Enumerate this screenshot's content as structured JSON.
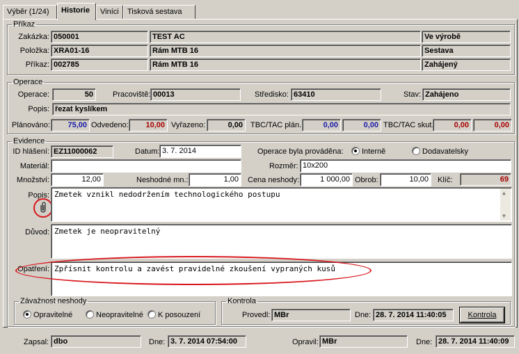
{
  "tabs": [
    "Výběr (1/24)",
    "Historie",
    "Viníci",
    "Tisková sestava"
  ],
  "prikaz": {
    "legend": "Příkaz",
    "zakazka": {
      "label": "Zakázka:",
      "code": "050001",
      "name": "TEST AC",
      "status": "Ve výrobě"
    },
    "polozka": {
      "label": "Položka:",
      "code": "XRA01-16",
      "name": "Rám MTB 16",
      "status": "Sestava"
    },
    "prikaz": {
      "label": "Příkaz:",
      "code": "002785",
      "name": "Rám MTB 16",
      "status": "Zahájený"
    }
  },
  "operace": {
    "legend": "Operace",
    "operace_label": "Operace:",
    "operace_value": "50",
    "pracoviste_label": "Pracoviště:",
    "pracoviste_value": "00013",
    "stredisko_label": "Středisko:",
    "stredisko_value": "63410",
    "stav_label": "Stav:",
    "stav_value": "Zahájeno",
    "popis_label": "Popis:",
    "popis_value": "řezat kyslíkem",
    "planovano_label": "Plánováno:",
    "planovano_value": "75,00",
    "odvedeno_label": "Odvedeno:",
    "odvedeno_value": "10,00",
    "vyrazeno_label": "Vyřazeno:",
    "vyrazeno_value": "0,00",
    "tbc_plan_label": "TBC/TAC plán.:",
    "tbc_plan_value1": "0,00",
    "tbc_plan_value2": "0,00",
    "tbc_skut_label": "TBC/TAC skut.:",
    "tbc_skut_value1": "0,00",
    "tbc_skut_value2": "0,00"
  },
  "evidence": {
    "legend": "Evidence",
    "id_label": "ID hlášení:",
    "id_value": "EZ11000062",
    "datum_label": "Datum:",
    "datum_value": "3. 7. 2014",
    "provadena_label": "Operace byla prováděna:",
    "interne_label": "Interně",
    "dodavatelsky_label": "Dodavatelsky",
    "material_label": "Materiál:",
    "material_value": "",
    "rozmer_label": "Rozměr:",
    "rozmer_value": "10x200",
    "mnozstvi_label": "Množství:",
    "mnozstvi_value": "12,00",
    "neshodne_label": "Neshodné mn.:",
    "neshodne_value": "1,00",
    "cena_label": "Cena neshody:",
    "cena_value": "1 000,00",
    "obrob_label": "Obrob:",
    "obrob_value": "10,00",
    "klic_label": "Klíč:",
    "klic_value": "69",
    "popis_label": "Popis:",
    "popis_text": "Zmetek vznikl nedodržením technologického postupu",
    "duvod_label": "Důvod:",
    "duvod_text": "Zmetek je neopravitelný",
    "opatreni_label": "Opatření:",
    "opatreni_text": "Zpřísnit kontrolu a zavést pravidelné zkoušení vypraných kusů"
  },
  "zavaznost": {
    "legend": "Závažnost neshody",
    "options": [
      "Opravitelné",
      "Neopravitelné",
      "K posouzení"
    ]
  },
  "kontrola": {
    "legend": "Kontrola",
    "provedl_label": "Provedl:",
    "provedl_value": "MBr",
    "dne_label": "Dne:",
    "dne_value": "28. 7. 2014 11:40:05",
    "button_label": "Kontrola"
  },
  "footer": {
    "zapsal_label": "Zapsal:",
    "zapsal_value": "dbo",
    "dne1_label": "Dne:",
    "dne1_value": "3. 7. 2014 07:54:00",
    "opravil_label": "Opravil:",
    "opravil_value": "MBr",
    "dne2_label": "Dne:",
    "dne2_value": "28. 7. 2014 11:40:09"
  },
  "icons": {
    "attachment": "paperclip-icon"
  },
  "colors": {
    "annotation": "#d8161c",
    "planned": "#1a1aa8",
    "done": "#a80000"
  }
}
